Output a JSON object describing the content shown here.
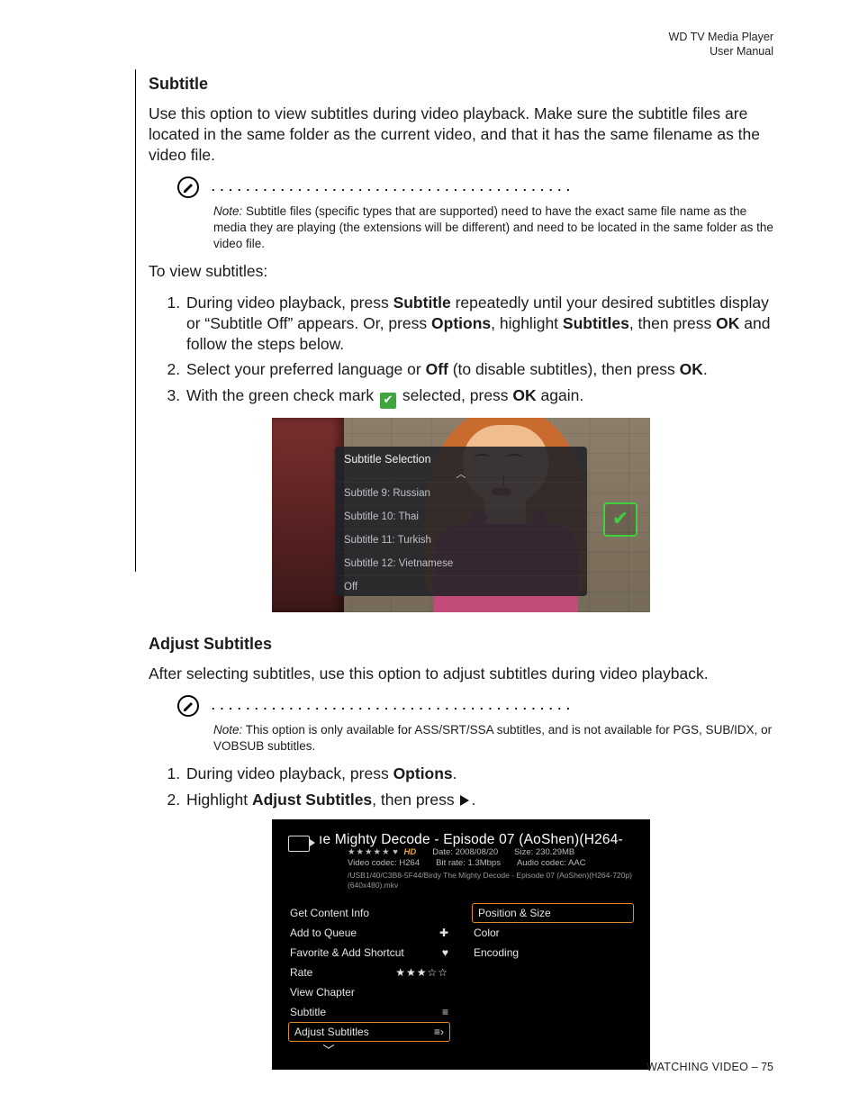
{
  "header": {
    "line1": "WD TV Media Player",
    "line2": "User Manual"
  },
  "sections": {
    "subtitle": {
      "heading": "Subtitle",
      "intro": "Use this option to view subtitles during video playback. Make sure the subtitle files are located in the same folder as the current video, and that it has the same filename as the video file.",
      "note_lead": "Note:",
      "note_body": "Subtitle files (specific types that are supported) need to have the exact same file name as the media they are playing (the extensions will be different) and need to be located in the same folder as the video file.",
      "to_view": "To view subtitles:",
      "steps": {
        "s1_a": "During video playback, press ",
        "s1_b1": "Subtitle",
        "s1_c": " repeatedly until your desired subtitles display or “Subtitle Off” appears. Or, press ",
        "s1_b2": "Options",
        "s1_d": ", highlight ",
        "s1_b3": "Subtitles",
        "s1_e": ", then press ",
        "s1_b4": "OK",
        "s1_f": " and follow the steps below.",
        "s2_a": "Select your preferred language or ",
        "s2_b1": "Off",
        "s2_c": " (to disable subtitles), then press ",
        "s2_b2": "OK",
        "s2_d": ".",
        "s3_a": "With the green check mark ",
        "s3_b": " selected, press ",
        "s3_b1": "OK",
        "s3_c": " again."
      }
    },
    "adjust": {
      "heading": "Adjust Subtitles",
      "intro": "After selecting subtitles, use this option to adjust subtitles during video playback.",
      "note_lead": "Note:",
      "note_body": "This option is only available for ASS/SRT/SSA subtitles, and is not available for PGS, SUB/IDX, or VOBSUB subtitles.",
      "steps": {
        "s1_a": "During video playback, press ",
        "s1_b1": "Options",
        "s1_c": ".",
        "s2_a": "Highlight ",
        "s2_b1": "Adjust Subtitles",
        "s2_c": ", then press ",
        "s2_d": "."
      }
    }
  },
  "shot1": {
    "panel_title": "Subtitle Selection",
    "options": [
      "Subtitle 9: Russian",
      "Subtitle 10: Thai",
      "Subtitle 11: Turkish",
      "Subtitle 12: Vietnamese",
      "Off"
    ]
  },
  "shot2": {
    "title": "ıe Mighty Decode - Episode 07 (AoShen)(H264-",
    "stars_top": "★★★★★",
    "hd": "HD",
    "meta_date_label": "Date:",
    "meta_date": "2008/08/20",
    "meta_size_label": "Size:",
    "meta_size": "230.29MB",
    "meta_vcodec_label": "Video codec:",
    "meta_vcodec": "H264",
    "meta_bitrate_label": "Bit rate:",
    "meta_bitrate": "1.3Mbps",
    "meta_acodec_label": "Audio codec:",
    "meta_acodec": "AAC",
    "path": "/USB1/40/C3B8-5F44/Birdy The Mighty Decode - Episode 07 (AoShen)(H264-720p)(640x480).mkv",
    "left_menu": [
      "Get Content Info",
      "Add to Queue",
      "Favorite & Add Shortcut",
      "Rate",
      "View Chapter",
      "Subtitle",
      "Adjust Subtitles"
    ],
    "left_selected_index": 6,
    "right_menu": [
      "Position & Size",
      "Color",
      "Encoding"
    ],
    "right_selected_index": 0,
    "rate_stars": "★★★☆☆"
  },
  "footer": {
    "section": "WATCHING VIDEO",
    "sep": " – ",
    "page": "75"
  }
}
